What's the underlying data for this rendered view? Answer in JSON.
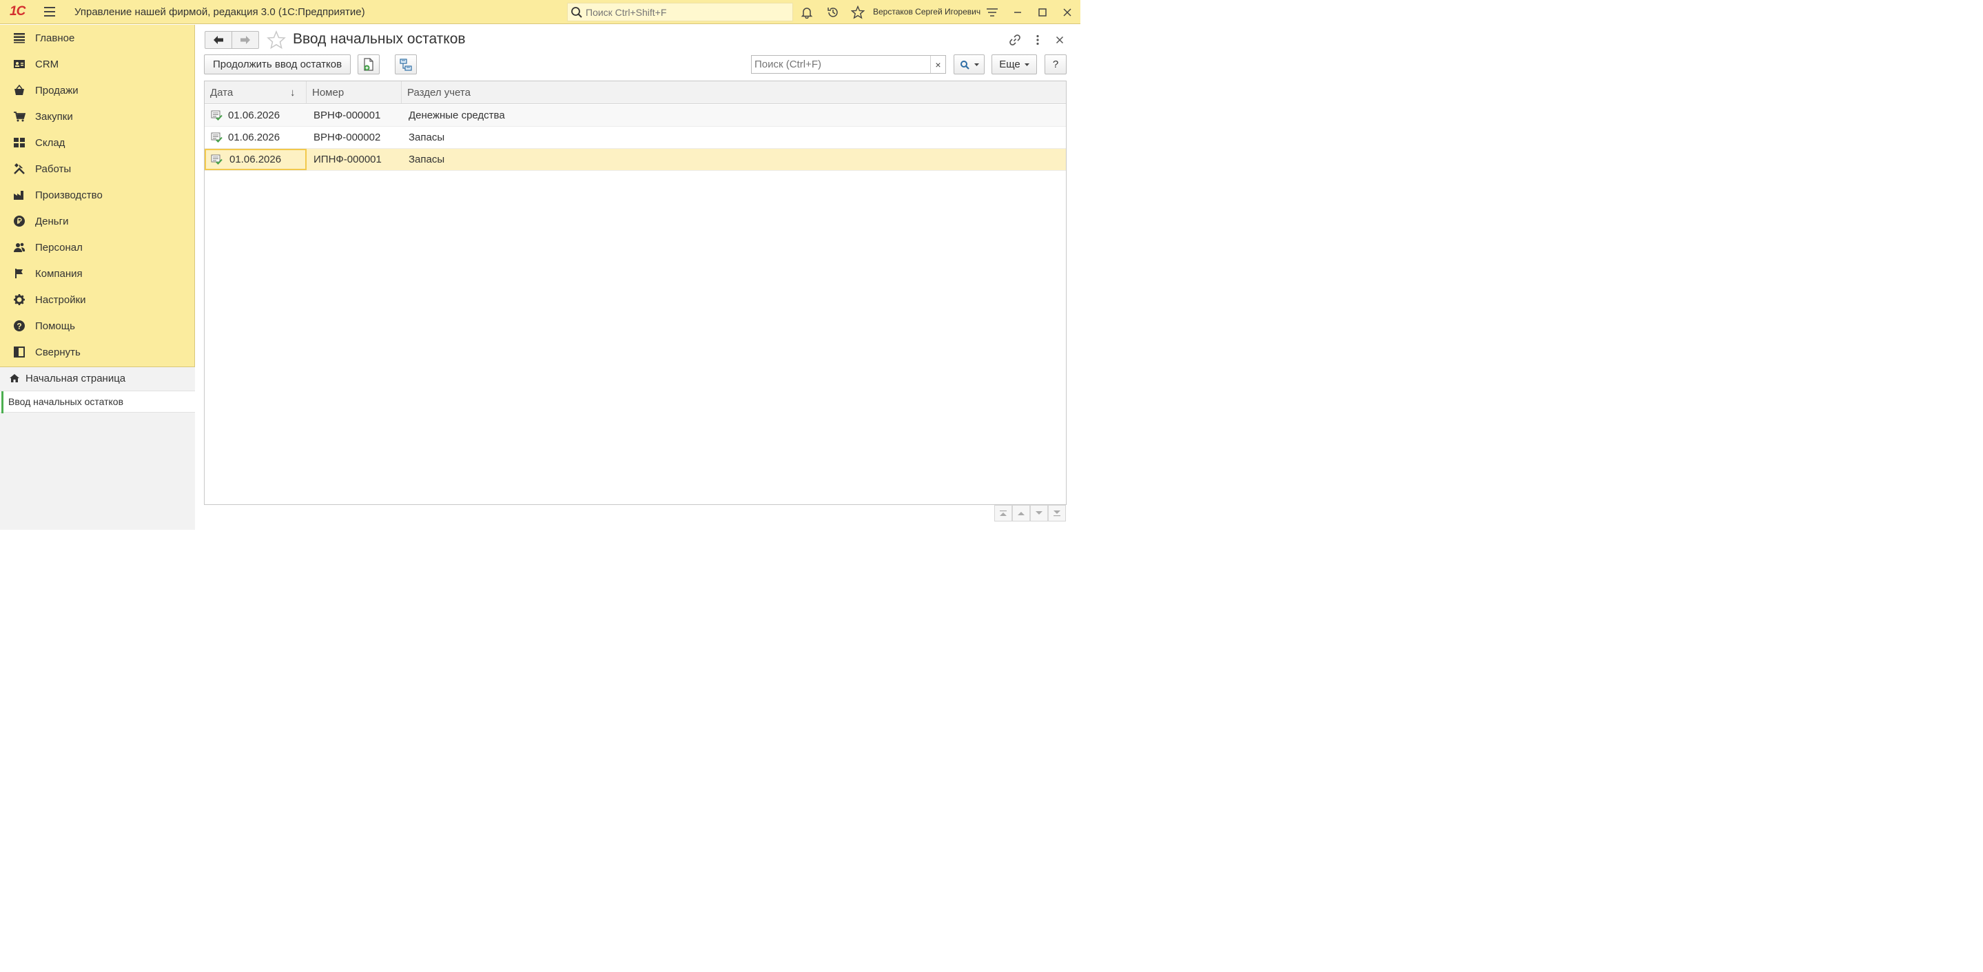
{
  "app": {
    "logo_text": "1С",
    "title": "Управление нашей фирмой, редакция 3.0  (1С:Предприятие)",
    "search_placeholder": "Поиск Ctrl+Shift+F",
    "user_name": "Верстаков Сергей Игоревич",
    "icons": [
      "menu-icon",
      "search-icon",
      "bell-icon",
      "history-icon",
      "star-icon",
      "settings-icon",
      "minimize-icon",
      "maximize-icon",
      "close-icon"
    ]
  },
  "sidebar": {
    "items": [
      {
        "label": "Главное",
        "icon": "list-icon"
      },
      {
        "label": "CRM",
        "icon": "contact-card-icon"
      },
      {
        "label": "Продажи",
        "icon": "basket-icon"
      },
      {
        "label": "Закупки",
        "icon": "cart-icon"
      },
      {
        "label": "Склад",
        "icon": "warehouse-icon"
      },
      {
        "label": "Работы",
        "icon": "tools-icon"
      },
      {
        "label": "Производство",
        "icon": "factory-icon"
      },
      {
        "label": "Деньги",
        "icon": "ruble-icon"
      },
      {
        "label": "Персонал",
        "icon": "people-icon"
      },
      {
        "label": "Компания",
        "icon": "flag-icon"
      },
      {
        "label": "Настройки",
        "icon": "gear-icon"
      },
      {
        "label": "Помощь",
        "icon": "help-icon"
      },
      {
        "label": "Свернуть",
        "icon": "collapse-panel-icon"
      }
    ],
    "open_windows": {
      "home": "Начальная страница",
      "current": "Ввод начальных остатков"
    }
  },
  "form": {
    "title": "Ввод начальных остатков",
    "continue_button": "Продолжить ввод остатков",
    "search_placeholder": "Поиск (Ctrl+F)",
    "clear_label": "×",
    "more_button": "Еще",
    "help_button": "?",
    "columns": [
      "Дата",
      "Номер",
      "Раздел учета"
    ],
    "sort_indicator": "↓",
    "rows": [
      {
        "date": "01.06.2026",
        "number": "ВРНФ-000001",
        "section": "Денежные средства"
      },
      {
        "date": "01.06.2026",
        "number": "ВРНФ-000002",
        "section": "Запасы"
      },
      {
        "date": "01.06.2026",
        "number": "ИПНФ-000001",
        "section": "Запасы"
      }
    ],
    "selected_row": 2
  },
  "colors": {
    "panel_yellow": "#fbec9e",
    "selected_row": "#fdf1c3",
    "selection_border": "#f2c94c",
    "logo_red": "#d32f2f",
    "posted_check_green": "#43a047"
  }
}
